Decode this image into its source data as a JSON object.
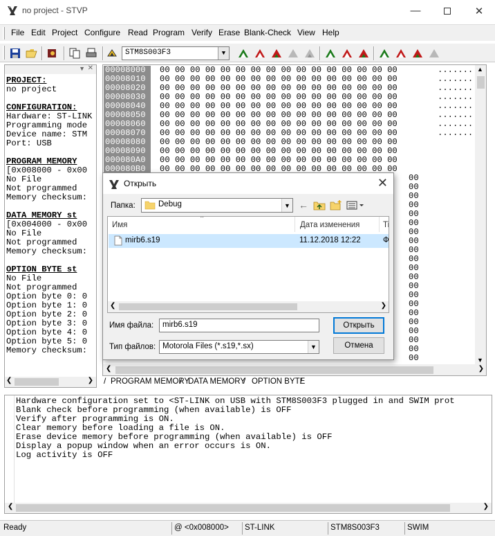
{
  "window": {
    "title": "no project - STVP"
  },
  "menu": [
    "File",
    "Edit",
    "Project",
    "Configure",
    "Read",
    "Program",
    "Verify",
    "Erase",
    "Blank-Check",
    "View",
    "Help"
  ],
  "toolbar": {
    "device": "STM8S003F3"
  },
  "left_panel": {
    "lines": [
      {
        "t": "PROJECT:",
        "h": true
      },
      {
        "t": "no project"
      },
      {
        "t": ""
      },
      {
        "t": "CONFIGURATION:",
        "h": true
      },
      {
        "t": "Hardware: ST-LINK"
      },
      {
        "t": "Programming mode"
      },
      {
        "t": "Device name: STM"
      },
      {
        "t": "Port: USB"
      },
      {
        "t": ""
      },
      {
        "t": "PROGRAM MEMORY",
        "h": true
      },
      {
        "t": "[0x008000 - 0x00"
      },
      {
        "t": "No File"
      },
      {
        "t": "Not programmed"
      },
      {
        "t": "Memory checksum:"
      },
      {
        "t": ""
      },
      {
        "t": "DATA MEMORY st",
        "h": true
      },
      {
        "t": "[0x004000 - 0x00"
      },
      {
        "t": "No File"
      },
      {
        "t": "Not programmed"
      },
      {
        "t": "Memory checksum:"
      },
      {
        "t": ""
      },
      {
        "t": "OPTION BYTE st",
        "h": true
      },
      {
        "t": "No File"
      },
      {
        "t": "Not programmed"
      },
      {
        "t": "Option byte 0: 0"
      },
      {
        "t": "Option byte 1: 0"
      },
      {
        "t": "Option byte 2: 0"
      },
      {
        "t": "Option byte 3: 0"
      },
      {
        "t": "Option byte 4: 0"
      },
      {
        "t": "Option byte 5: 0"
      },
      {
        "t": "Memory checksum:"
      }
    ]
  },
  "hex": {
    "addresses": [
      "00008000",
      "00008010",
      "00008020",
      "00008030",
      "00008040",
      "00008050",
      "00008060",
      "00008070",
      "00008080",
      "00008090",
      "000080A0",
      "000080B0"
    ],
    "row_bytes": "00 00 00 00 00 00 00 00 00 00 00 00 00 00 00 00",
    "row_ascii": "........",
    "partial_bytes": "00",
    "rows_total": 33
  },
  "tabs": [
    "PROGRAM MEMORY",
    "DATA MEMORY",
    "OPTION BYTE"
  ],
  "log": [
    "Hardware configuration set to <ST-LINK on USB with STM8S003F3 plugged in and SWIM prot",
    "Blank check before programming (when available) is OFF",
    "Verify after programming is ON.",
    "Clear memory before loading a file is ON.",
    "Erase device memory before programming (when available) is OFF",
    "Display a popup window when an error occurs is ON.",
    "Log activity is OFF"
  ],
  "status": [
    "Ready",
    "@ <0x008000>",
    "ST-LINK",
    "STM8S003F3",
    "SWIM"
  ],
  "dialog": {
    "title": "Открыть",
    "folder_label": "Папка:",
    "folder": "Debug",
    "columns": [
      "Имя",
      "Дата изменения",
      "Ti"
    ],
    "file": {
      "name": "mirb6.s19",
      "date": "11.12.2018 12:22",
      "type": "Ф"
    },
    "filename_label": "Имя файла:",
    "filename": "mirb6.s19",
    "filetype_label": "Тип файлов:",
    "filetype": "Motorola Files (*.s19,*.sx)",
    "open_button": "Открыть",
    "cancel_button": "Отмена"
  }
}
